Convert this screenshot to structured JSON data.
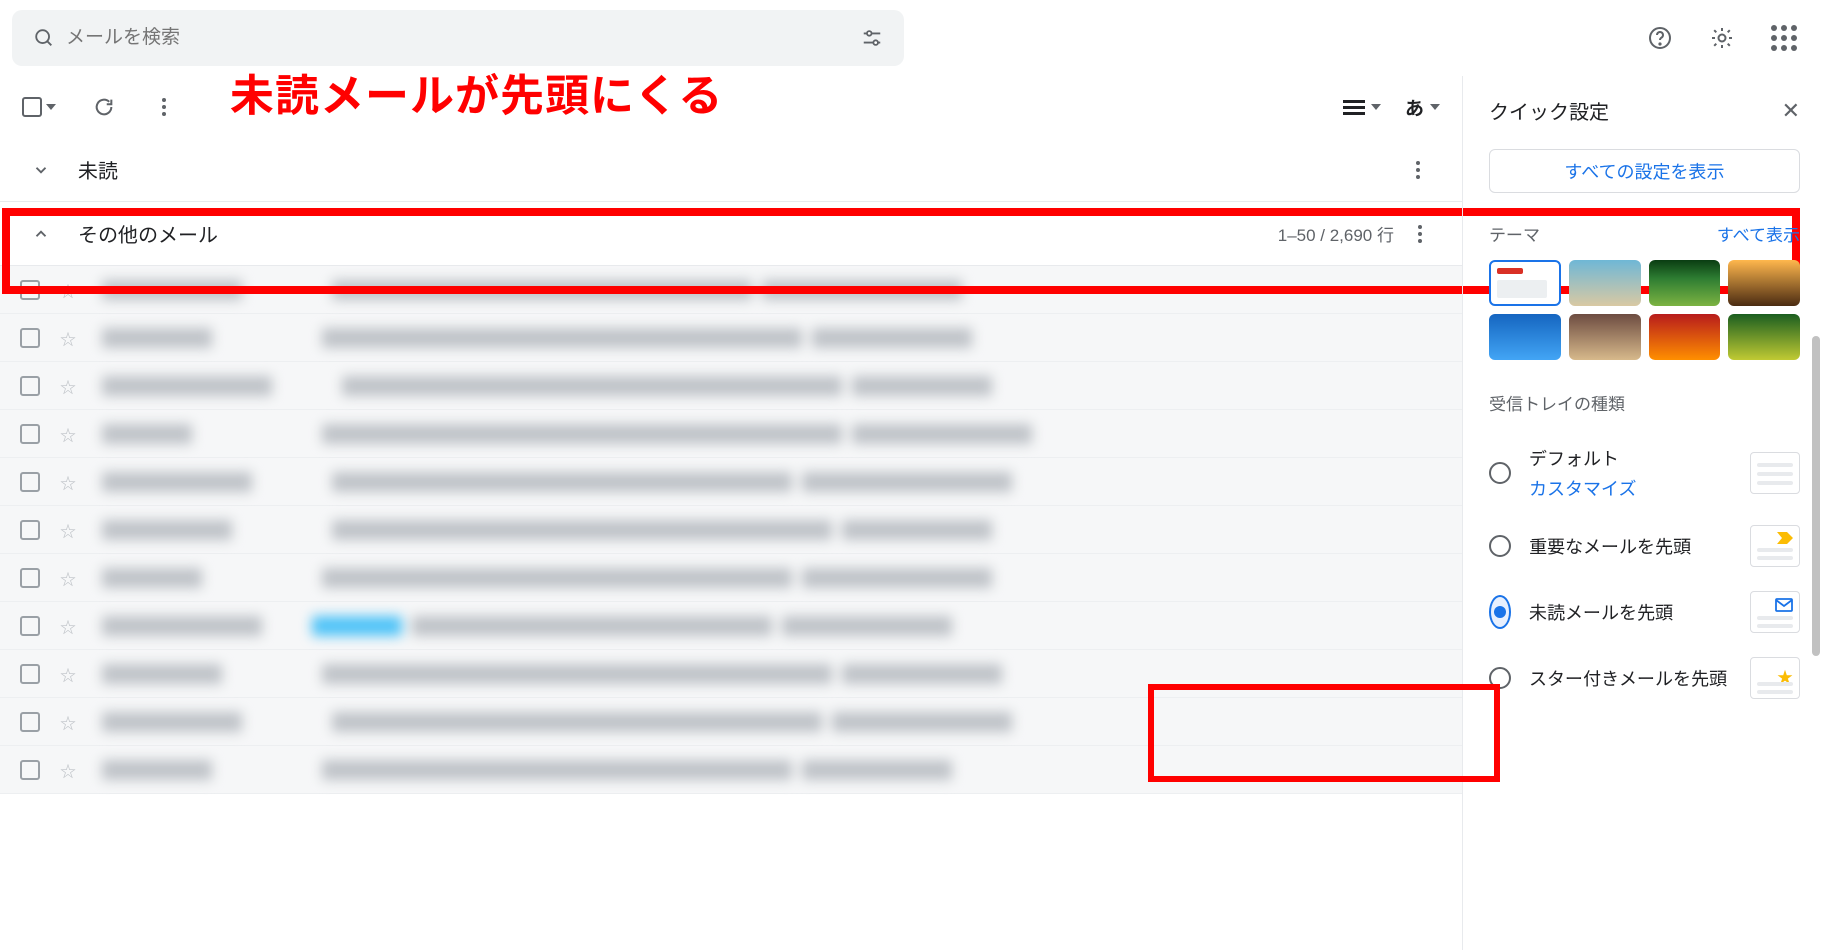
{
  "annotation": "未読メールが先頭にくる",
  "search": {
    "placeholder": "メールを検索"
  },
  "sections": {
    "unread_label": "未読",
    "other_label": "その他のメール",
    "range": "1–50 / 2,690 行"
  },
  "panel": {
    "title": "クイック設定",
    "full_settings": "すべての設定を表示",
    "theme_label": "テーマ",
    "theme_all": "すべて表示",
    "inbox_type_label": "受信トレイの種類",
    "types": {
      "default": "デフォルト",
      "customize": "カスタマイズ",
      "important": "重要なメールを先頭",
      "unread": "未読メールを先頭",
      "starred": "スター付きメールを先頭"
    }
  }
}
